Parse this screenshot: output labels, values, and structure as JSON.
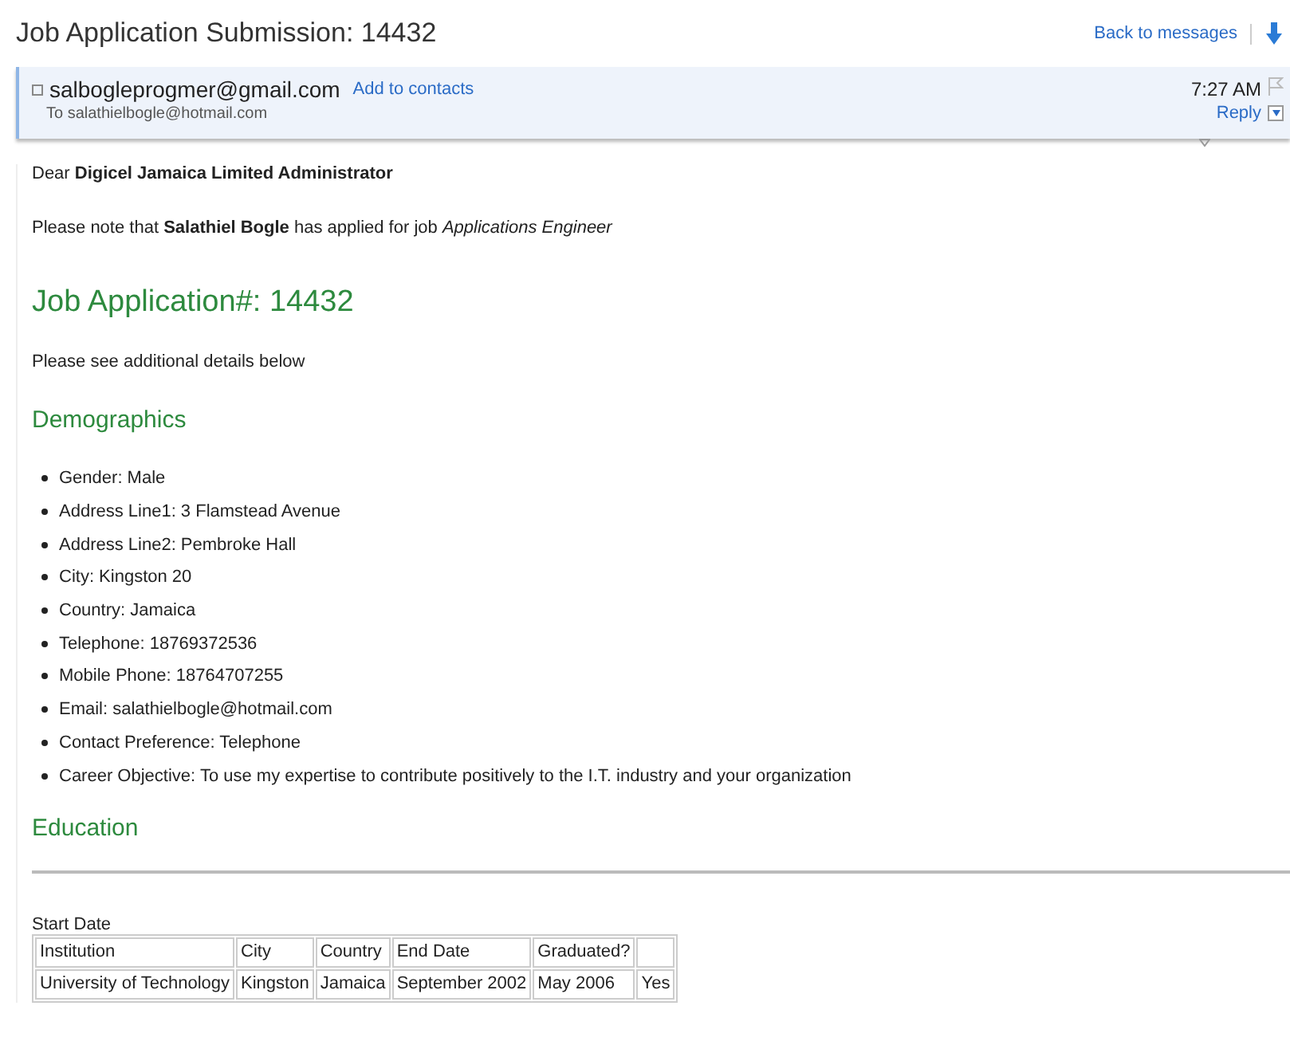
{
  "title": "Job Application Submission: 14432",
  "back_link": "Back to messages",
  "message": {
    "from": "salbogleprogmer@gmail.com",
    "add_contact": "Add to contacts",
    "to": "To salathielbogle@hotmail.com",
    "time": "7:27 AM",
    "reply": "Reply"
  },
  "body": {
    "greeting": "Dear **Digicel Jamaica Limited Administrator**",
    "note": "Please note that **Salathiel Bogle** has applied for job *Applications Engineer*",
    "heading": "Job Application#: 14432",
    "intro": "Please see additional details below",
    "sections": [
      {
        "kind": "list",
        "title": "Demographics",
        "items": [
          "Gender: Male",
          "Address Line1: 3 Flamstead Avenue",
          "Address Line2: Pembroke Hall",
          "City: Kingston 20",
          "Country: Jamaica",
          "Telephone: 18769372536",
          "Mobile Phone: 18764707255",
          "Email: salathielbogle@hotmail.com",
          "Contact Preference: Telephone",
          "Career Objective: To use my expertise to contribute positively to the I.T. industry and your organization"
        ]
      },
      {
        "kind": "table",
        "title": "Education",
        "caption": "Start Date",
        "columns": [
          "Institution",
          "City",
          "Country",
          "End Date",
          "Graduated?"
        ],
        "rows": [
          [
            "University of Technology",
            "Kingston",
            "Jamaica",
            "September 2002",
            "May 2006",
            "Yes"
          ]
        ]
      }
    ]
  }
}
